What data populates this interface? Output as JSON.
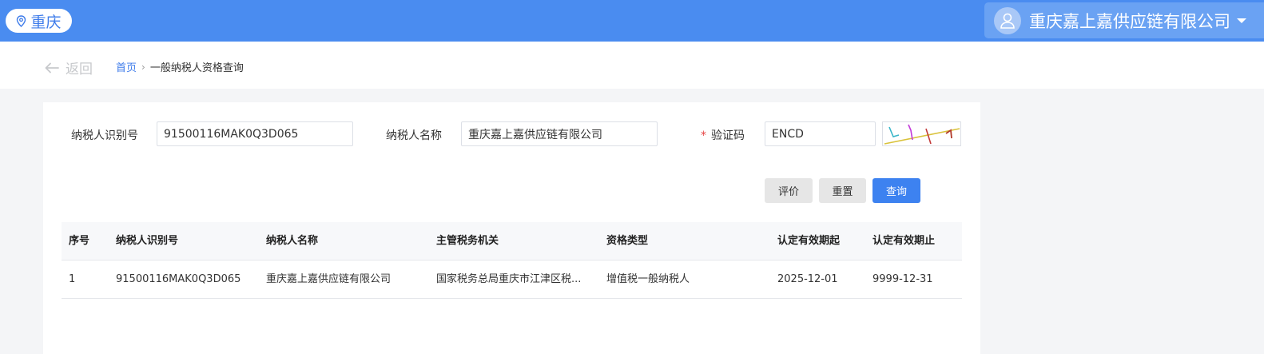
{
  "header": {
    "city": "重庆",
    "company": "重庆嘉上嘉供应链有限公司",
    "accent_color": "#4a8cf0"
  },
  "breadcrumb": {
    "back_label": "返回",
    "home": "首页",
    "separator": "›",
    "current": "一般纳税人资格查询"
  },
  "form": {
    "taxpayer_id_label": "纳税人识别号",
    "taxpayer_id_value": "91500116MAK0Q3D065",
    "taxpayer_name_label": "纳税人名称",
    "taxpayer_name_value": "重庆嘉上嘉供应链有限公司",
    "captcha_required_mark": "*",
    "captcha_label": "验证码",
    "captcha_value": "ENCD"
  },
  "buttons": {
    "evaluate": "评价",
    "reset": "重置",
    "query": "查询"
  },
  "table": {
    "columns": [
      "序号",
      "纳税人识别号",
      "纳税人名称",
      "主管税务机关",
      "资格类型",
      "认定有效期起",
      "认定有效期止"
    ],
    "rows": [
      [
        "1",
        "91500116MAK0Q3D065",
        "重庆嘉上嘉供应链有限公司",
        "国家税务总局重庆市江津区税...",
        "增值税一般纳税人",
        "2025-12-01",
        "9999-12-31"
      ]
    ]
  }
}
